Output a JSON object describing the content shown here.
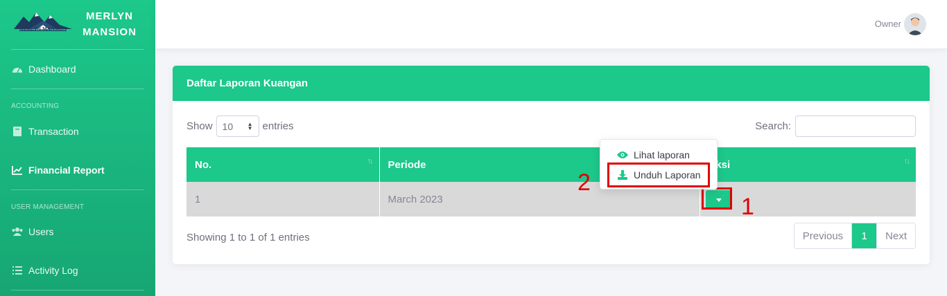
{
  "sidebar": {
    "brand": {
      "name_line1": "MERLYN",
      "name_line2": "MANSION",
      "logo_text": "MERLYN MANSION"
    },
    "items": [
      {
        "label": "Dashboard",
        "icon": "tachometer-icon"
      },
      {
        "label": "Transaction",
        "icon": "book-icon"
      },
      {
        "label": "Financial Report",
        "icon": "chart-line-icon"
      },
      {
        "label": "Users",
        "icon": "users-icon"
      },
      {
        "label": "Activity Log",
        "icon": "list-icon"
      }
    ],
    "headings": {
      "accounting": "ACCOUNTING",
      "user_management": "USER MANAGEMENT"
    }
  },
  "topbar": {
    "user_name": "Owner"
  },
  "card": {
    "title": "Daftar Laporan Kuangan",
    "show_label": "Show",
    "entries_value": "10",
    "entries_label": "entries",
    "search_label": "Search:",
    "search_value": "",
    "columns": [
      "No.",
      "Periode",
      "Aksi"
    ],
    "rows": [
      {
        "no": "1",
        "periode": "March 2023"
      }
    ],
    "showing_text": "Showing 1 to 1 of 1 entries",
    "pagination": {
      "previous": "Previous",
      "current": "1",
      "next": "Next"
    }
  },
  "dropdown": {
    "items": [
      {
        "label": "Lihat laporan",
        "icon": "eye-icon"
      },
      {
        "label": "Unduh Laporan",
        "icon": "download-icon"
      }
    ]
  },
  "annotations": {
    "step1": "1",
    "step2": "2",
    "color": "#e00000"
  },
  "colors": {
    "accent": "#1cc88a"
  }
}
